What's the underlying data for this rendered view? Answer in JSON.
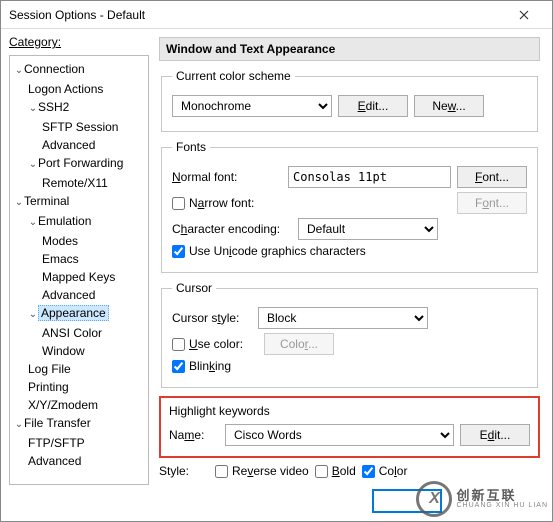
{
  "window": {
    "title": "Session Options - Default"
  },
  "category_label": "Category:",
  "tree": {
    "connection": "Connection",
    "logon_actions": "Logon Actions",
    "ssh2": "SSH2",
    "sftp_session": "SFTP Session",
    "advanced1": "Advanced",
    "port_fwd": "Port Forwarding",
    "remote_x11": "Remote/X11",
    "terminal": "Terminal",
    "emulation": "Emulation",
    "modes": "Modes",
    "emacs": "Emacs",
    "mapped_keys": "Mapped Keys",
    "advanced2": "Advanced",
    "appearance": "Appearance",
    "ansi_color": "ANSI Color",
    "window_item": "Window",
    "log_file": "Log File",
    "printing": "Printing",
    "xyzmodem": "X/Y/Zmodem",
    "file_transfer": "File Transfer",
    "ftp_sftp": "FTP/SFTP",
    "advanced3": "Advanced"
  },
  "panel": {
    "header": "Window and Text Appearance",
    "color_scheme": {
      "legend": "Current color scheme",
      "value": "Monochrome",
      "edit": "Edit...",
      "new": "New..."
    },
    "fonts": {
      "legend": "Fonts",
      "normal_label": "Normal font:",
      "normal_value": "Consolas 11pt",
      "font_btn": "Font...",
      "narrow_label": "Narrow font:",
      "encoding_label": "Character encoding:",
      "encoding_value": "Default",
      "unicode_label": "Use Unicode graphics characters"
    },
    "cursor": {
      "legend": "Cursor",
      "style_label": "Cursor style:",
      "style_value": "Block",
      "use_color_label": "Use color:",
      "color_btn": "Color...",
      "blinking_label": "Blinking"
    },
    "highlight": {
      "legend": "Highlight keywords",
      "name_label": "Name:",
      "name_value": "Cisco Words",
      "edit": "Edit..."
    },
    "style": {
      "label": "Style:",
      "reverse": "Reverse video",
      "bold": "Bold",
      "color": "Color"
    }
  },
  "watermark": {
    "cn": "创新互联",
    "py": "CHUANG XIN HU LIAN"
  }
}
